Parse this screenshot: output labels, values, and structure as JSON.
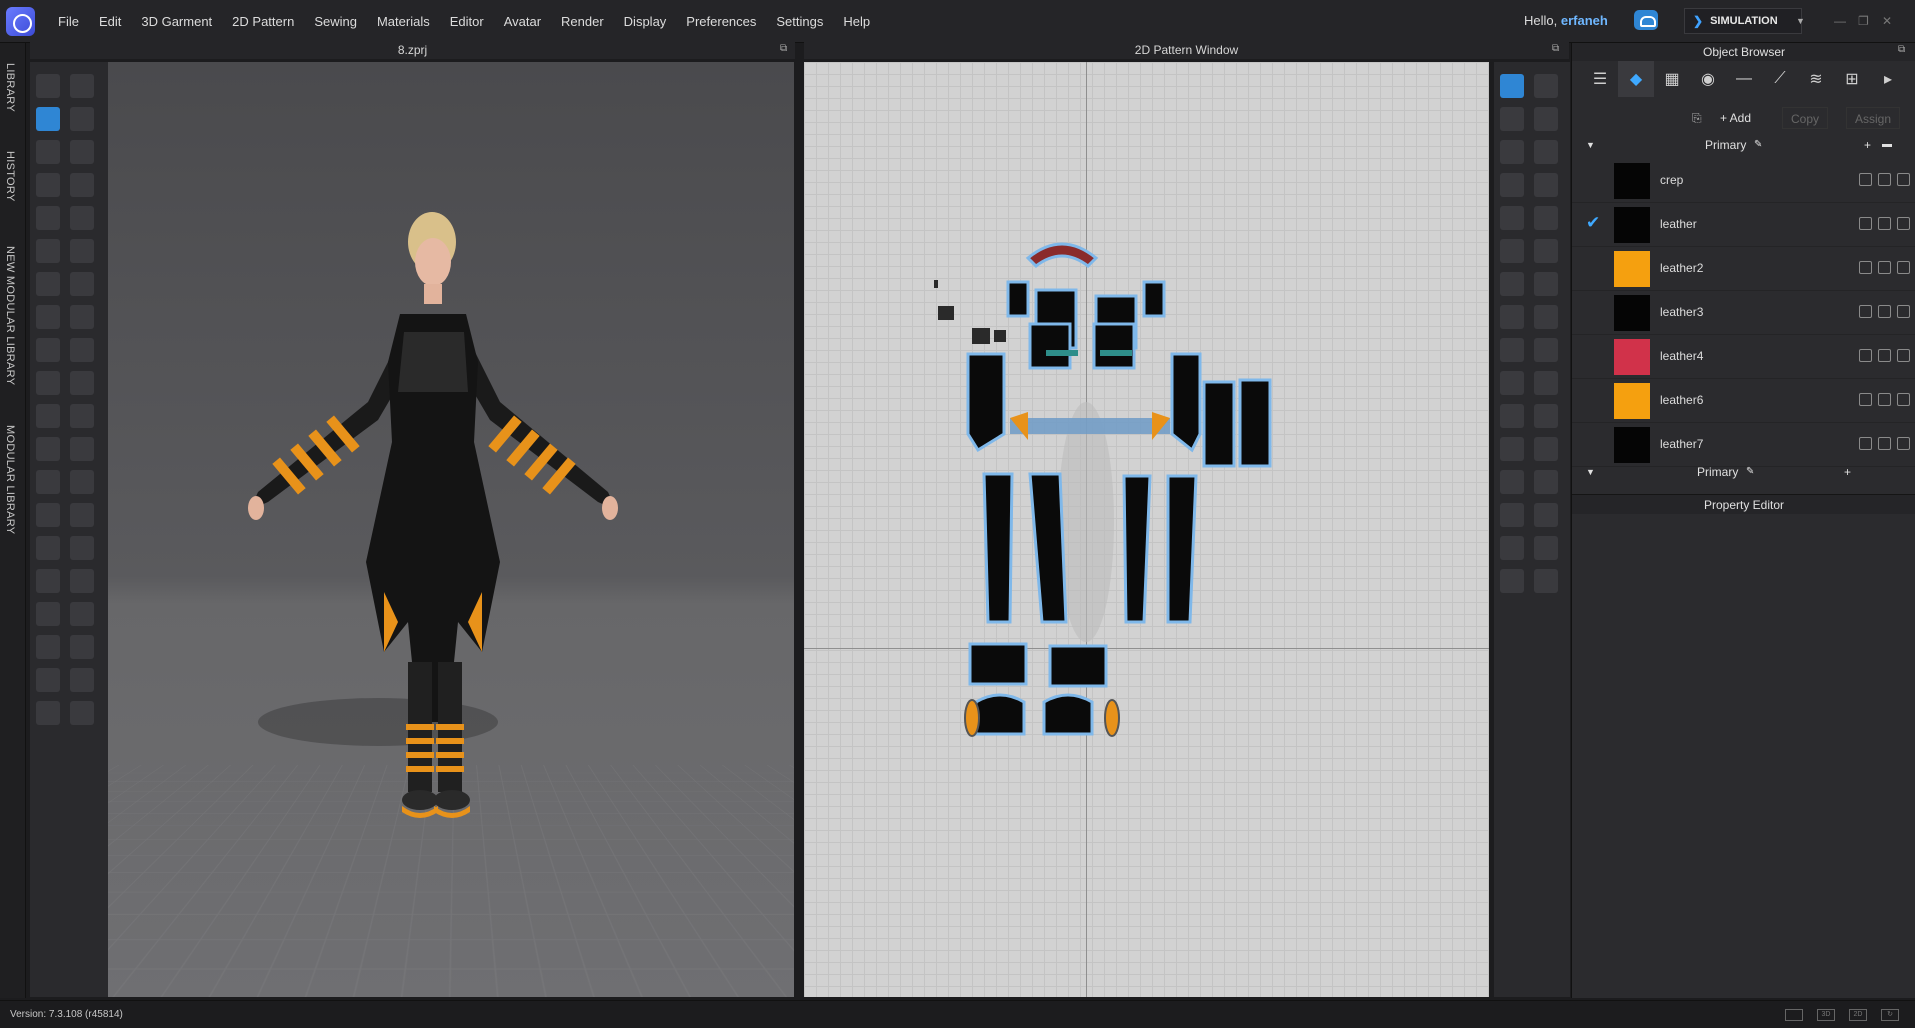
{
  "menubar": {
    "items": [
      "File",
      "Edit",
      "3D Garment",
      "2D Pattern",
      "Sewing",
      "Materials",
      "Editor",
      "Avatar",
      "Render",
      "Display",
      "Preferences",
      "Settings",
      "Help"
    ],
    "greeting": "Hello,",
    "username": "erfaneh",
    "mode_label": "SIMULATION"
  },
  "side_tabs": [
    "LIBRARY",
    "HISTORY",
    "NEW MODULAR LIBRARY",
    "MODULAR LIBRARY"
  ],
  "viewport3d": {
    "title": "8.zprj"
  },
  "pattern2d": {
    "title": "2D Pattern Window"
  },
  "object_browser": {
    "title": "Object Browser",
    "add_label": "+ Add",
    "copy_label": "Copy",
    "assign_label": "Assign",
    "group_label": "Primary",
    "group_label_bottom": "Primary",
    "materials": [
      {
        "name": "crep",
        "color": "#050505",
        "selected": false
      },
      {
        "name": "leather",
        "color": "#050505",
        "selected": true
      },
      {
        "name": "leather2",
        "color": "#f5a00f",
        "selected": false
      },
      {
        "name": "leather3",
        "color": "#050505",
        "selected": false
      },
      {
        "name": "leather4",
        "color": "#d1324a",
        "selected": false
      },
      {
        "name": "leather6",
        "color": "#f5a00f",
        "selected": false
      },
      {
        "name": "leather7",
        "color": "#050505",
        "selected": false
      }
    ]
  },
  "property_editor": {
    "title": "Property Editor"
  },
  "status": {
    "version": "Version: 7.3.108 (r45814)"
  },
  "colors": {
    "accent": "#3fa9ff",
    "username": "#6fb7ff"
  }
}
